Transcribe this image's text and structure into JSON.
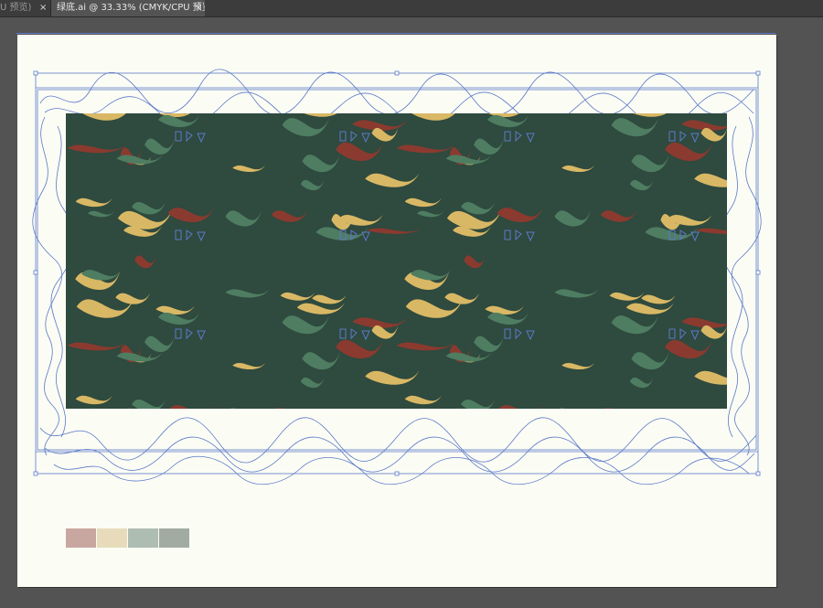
{
  "tabs": [
    {
      "label": "PU 预览)",
      "close": "×"
    },
    {
      "label": "绿底.ai @ 33.33% (CMYK/CPU 预览)",
      "close": "×"
    }
  ],
  "colors": {
    "workspace": "#535353",
    "artboard": "#fbfcf4",
    "pattern_ground": "#2f4a3e",
    "motif_gold": "#d9b865",
    "motif_red": "#8b3a2f",
    "motif_green": "#4e7d62",
    "outline_blue": "#5b79c9"
  },
  "swatches": [
    {
      "name": "dusty-rose",
      "color": "#c8a7a0"
    },
    {
      "name": "cream",
      "color": "#e8dbbb"
    },
    {
      "name": "sage",
      "color": "#aebdb2"
    },
    {
      "name": "gray-green",
      "color": "#a2aba1"
    }
  ]
}
